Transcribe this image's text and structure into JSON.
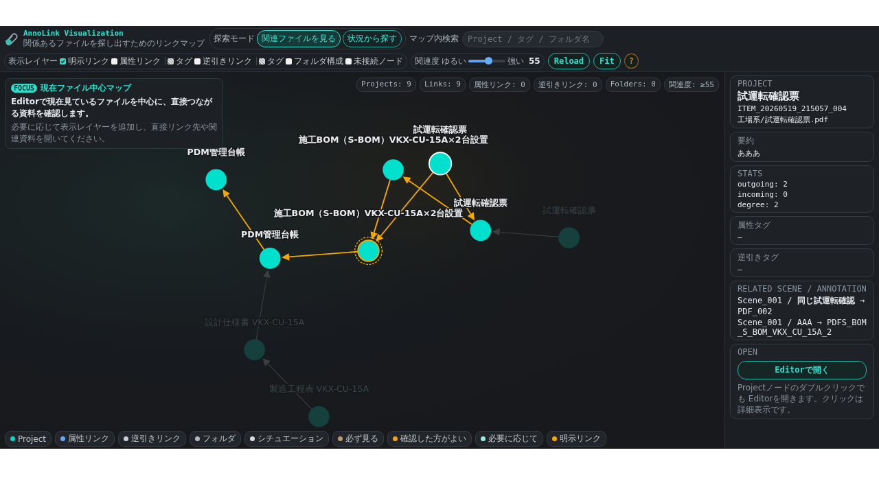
{
  "header": {
    "title": "AnnoLink Visualization",
    "subtitle": "関係あるファイルを探し出すためのリンクマップ"
  },
  "mode": {
    "label": "探索モード",
    "options": [
      {
        "label": "関連ファイルを見る",
        "selected": true
      },
      {
        "label": "状況から探す",
        "selected": false
      }
    ]
  },
  "search": {
    "label": "マップ内検索",
    "placeholder": "Project / タグ / フォルダ名"
  },
  "layers": {
    "label": "表示レイヤー",
    "items": [
      {
        "label": "明示リンク",
        "checked": true,
        "disabled": false,
        "divider_after": false
      },
      {
        "label": "属性リンク",
        "checked": false,
        "disabled": false,
        "divider_after": true
      },
      {
        "label": "タグ",
        "checked": false,
        "disabled": true,
        "divider_after": false
      },
      {
        "label": "逆引きリンク",
        "checked": false,
        "disabled": false,
        "divider_after": true
      },
      {
        "label": "タグ",
        "checked": false,
        "disabled": true,
        "divider_after": false
      },
      {
        "label": "フォルダ構成",
        "checked": false,
        "disabled": false,
        "divider_after": false
      },
      {
        "label": "未接続ノード",
        "checked": false,
        "disabled": false,
        "divider_after": false
      }
    ]
  },
  "relevance": {
    "label": "関連度",
    "min_label": "ゆるい",
    "max_label": "強い",
    "level": 0.55,
    "reading": "55"
  },
  "buttons": [
    "Reload",
    "Fit",
    "?"
  ],
  "focus_card": {
    "badge": "FOCUS",
    "title": "現在ファイル中心マップ",
    "text": "Editorで現在見ているファイルを中心に、直接つながる資料を確認します。",
    "hint": "必要に応じて表示レイヤーを追加し、直接リンク先や関連資料を開いてください。"
  },
  "stats_pills": [
    "Projects: 9",
    "Links: 9",
    "属性リンク: 0",
    "逆引きリンク: 0",
    "Folders: 0",
    "関連度: ≥55"
  ],
  "graph": {
    "nodes": [
      {
        "label": "試運転確認票",
        "kind": "project",
        "selected": true,
        "dimmed": false
      },
      {
        "label": "施工BOM（S-BOM）VKX-CU-15A×2台設置",
        "kind": "project",
        "selected": false,
        "dimmed": false
      },
      {
        "label": "PDM管理台帳",
        "kind": "project",
        "selected": false,
        "dimmed": false
      },
      {
        "label": "試運転確認票",
        "kind": "project",
        "selected": false,
        "dimmed": false
      },
      {
        "label": "試運転確認票",
        "kind": "project",
        "selected": false,
        "dimmed": true
      },
      {
        "label": "施工BOM（S-BOM）VKX-CU-15A×2台設置",
        "kind": "current",
        "selected": false,
        "dimmed": false
      },
      {
        "label": "PDM管理台帳",
        "kind": "project",
        "selected": false,
        "dimmed": false
      },
      {
        "label": "設計仕様書 VKX-CU-15A",
        "kind": "project",
        "selected": false,
        "dimmed": true
      },
      {
        "label": "製造工程表 VKX-CU-15A",
        "kind": "project",
        "selected": false,
        "dimmed": true
      }
    ]
  },
  "legend": [
    {
      "label": "Project",
      "color": "#00d8c8"
    },
    {
      "label": "属性リンク",
      "color": "#6aa6f0"
    },
    {
      "label": "逆引きリンク",
      "color": "#c8cdd6"
    },
    {
      "label": "フォルダ",
      "color": "#b4b8c0"
    },
    {
      "label": "シチュエーション",
      "color": "#dcdce0"
    },
    {
      "label": "必ず見る",
      "color": "#b89a78"
    },
    {
      "label": "確認した方がよい",
      "color": "#f0a020"
    },
    {
      "label": "必要に応じて",
      "color": "#a0e8e0"
    },
    {
      "label": "明示リンク",
      "color": "#f5a800"
    }
  ],
  "sidebar": {
    "project": {
      "caption": "PROJECT",
      "title": "試運転確認票",
      "id": "ITEM_20260519_215057_004",
      "path": "工場系/試運転確認票.pdf"
    },
    "summary": {
      "caption": "要約",
      "text": "あああ"
    },
    "stats": {
      "caption": "STATS",
      "lines": [
        "outgoing: 2",
        "incoming: 0",
        "degree: 2"
      ]
    },
    "attribute_tags": {
      "caption": "属性タグ",
      "value": "—"
    },
    "reverse_tags": {
      "caption": "逆引きタグ",
      "value": "—"
    },
    "related": {
      "caption": "RELATED SCENE / ANNOTATION",
      "lines": [
        "Scene_001 / **同じ試運転確認** → PDF_002",
        "Scene_001 / AAA → PDFS_BOM_S_BOM_VKX_CU_15A_2"
      ]
    },
    "open": {
      "caption": "OPEN",
      "button": "Editorで開く",
      "note": "Projectノードのダブルクリックでも Editorを開きます。クリックは詳細表示です。"
    }
  }
}
